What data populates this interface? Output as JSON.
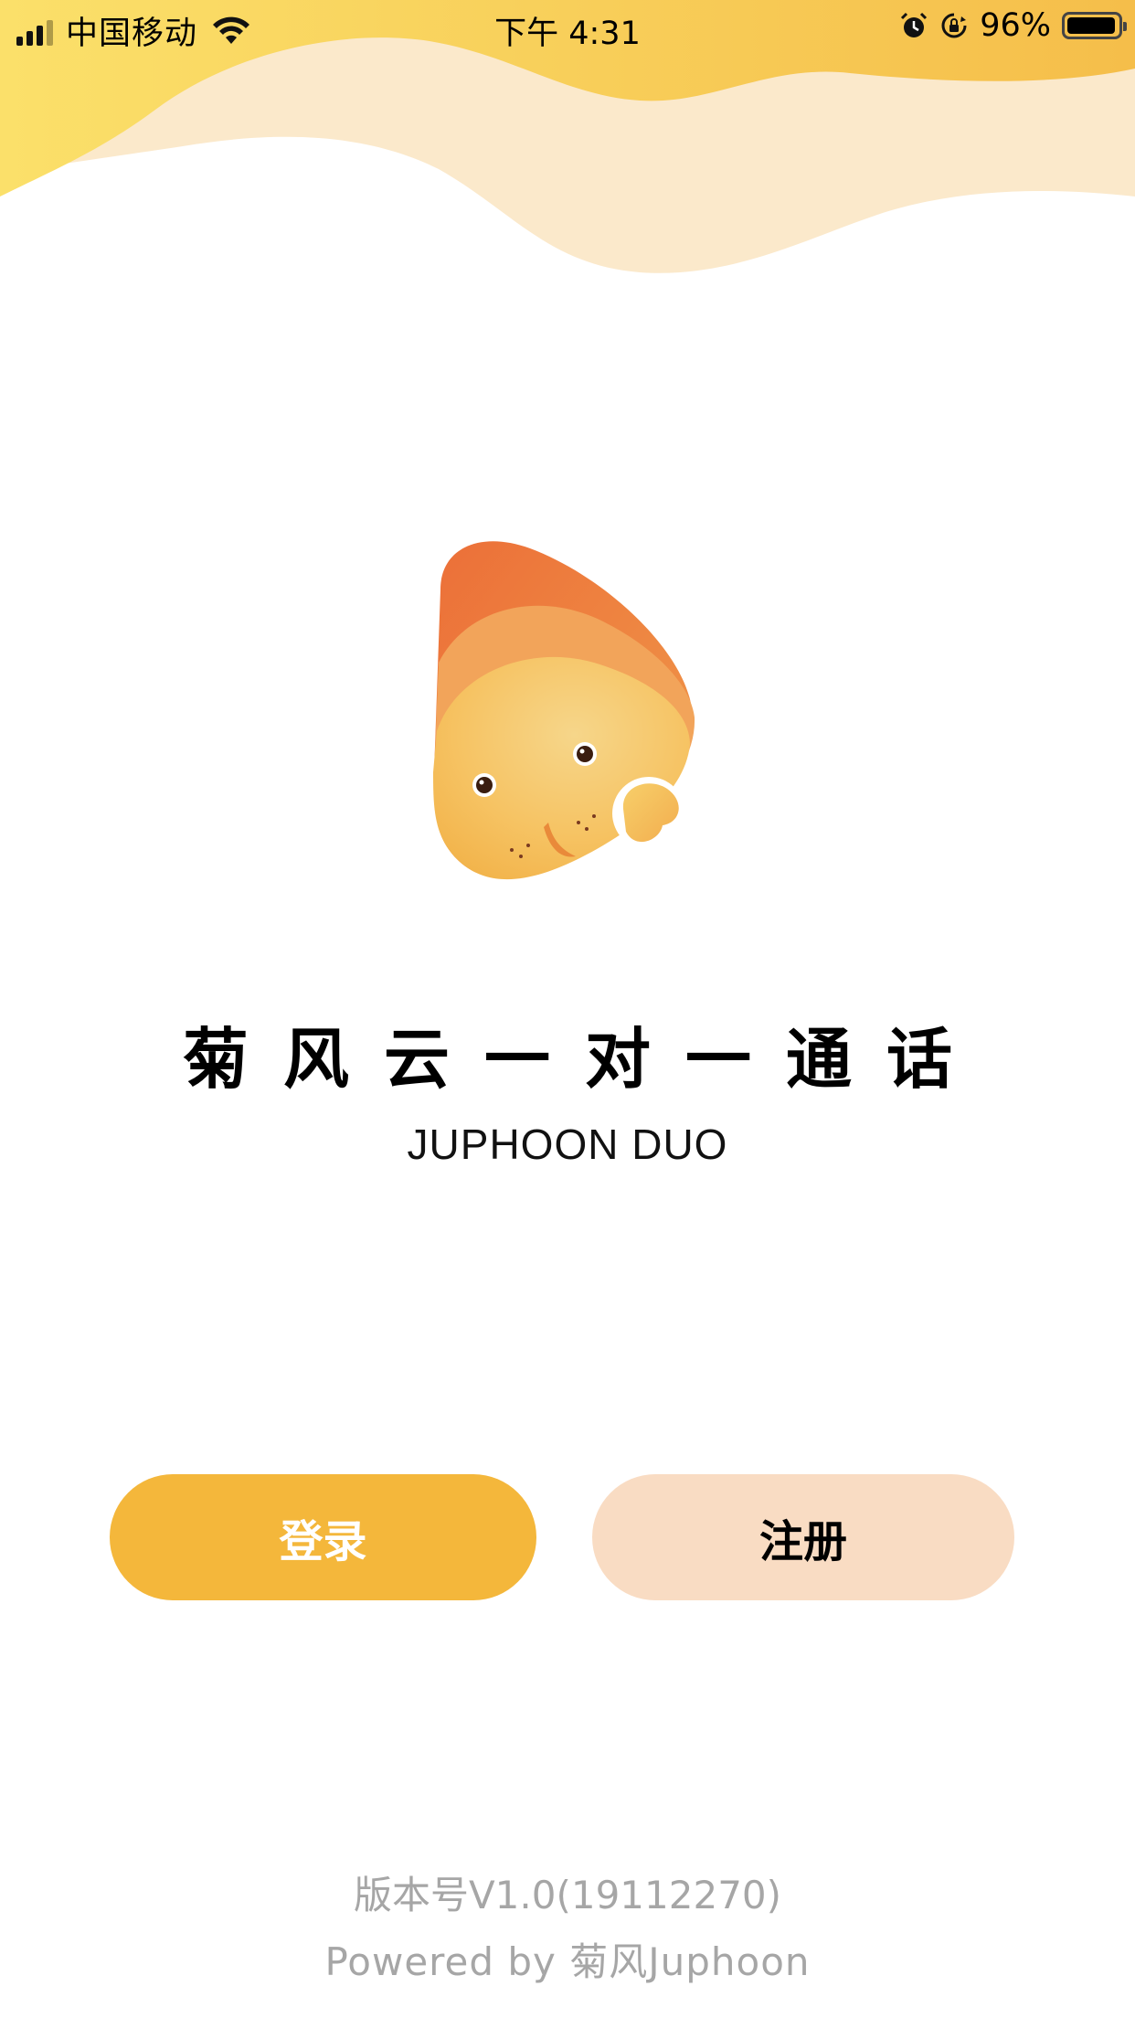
{
  "status_bar": {
    "carrier": "中国移动",
    "time": "下午 4:31",
    "battery_percent": "96%",
    "battery_level": 0.96,
    "icons": [
      "signal-icon",
      "wifi-icon",
      "alarm-icon",
      "rotation-lock-icon",
      "battery-icon"
    ]
  },
  "app": {
    "title": "菊风云一对一通话",
    "subtitle": "JUPHOON DUO"
  },
  "buttons": {
    "login": "登录",
    "register": "注册"
  },
  "footer": {
    "version": "版本号V1.0(19112270)",
    "powered_by": "Powered by 菊风Juphoon"
  },
  "colors": {
    "accent": "#f4b73b",
    "secondary_button": "#f9dcc3",
    "wave_yellow": "#f8cf57",
    "wave_light": "#fbe9cb",
    "footer_text": "#a6a6a6"
  }
}
